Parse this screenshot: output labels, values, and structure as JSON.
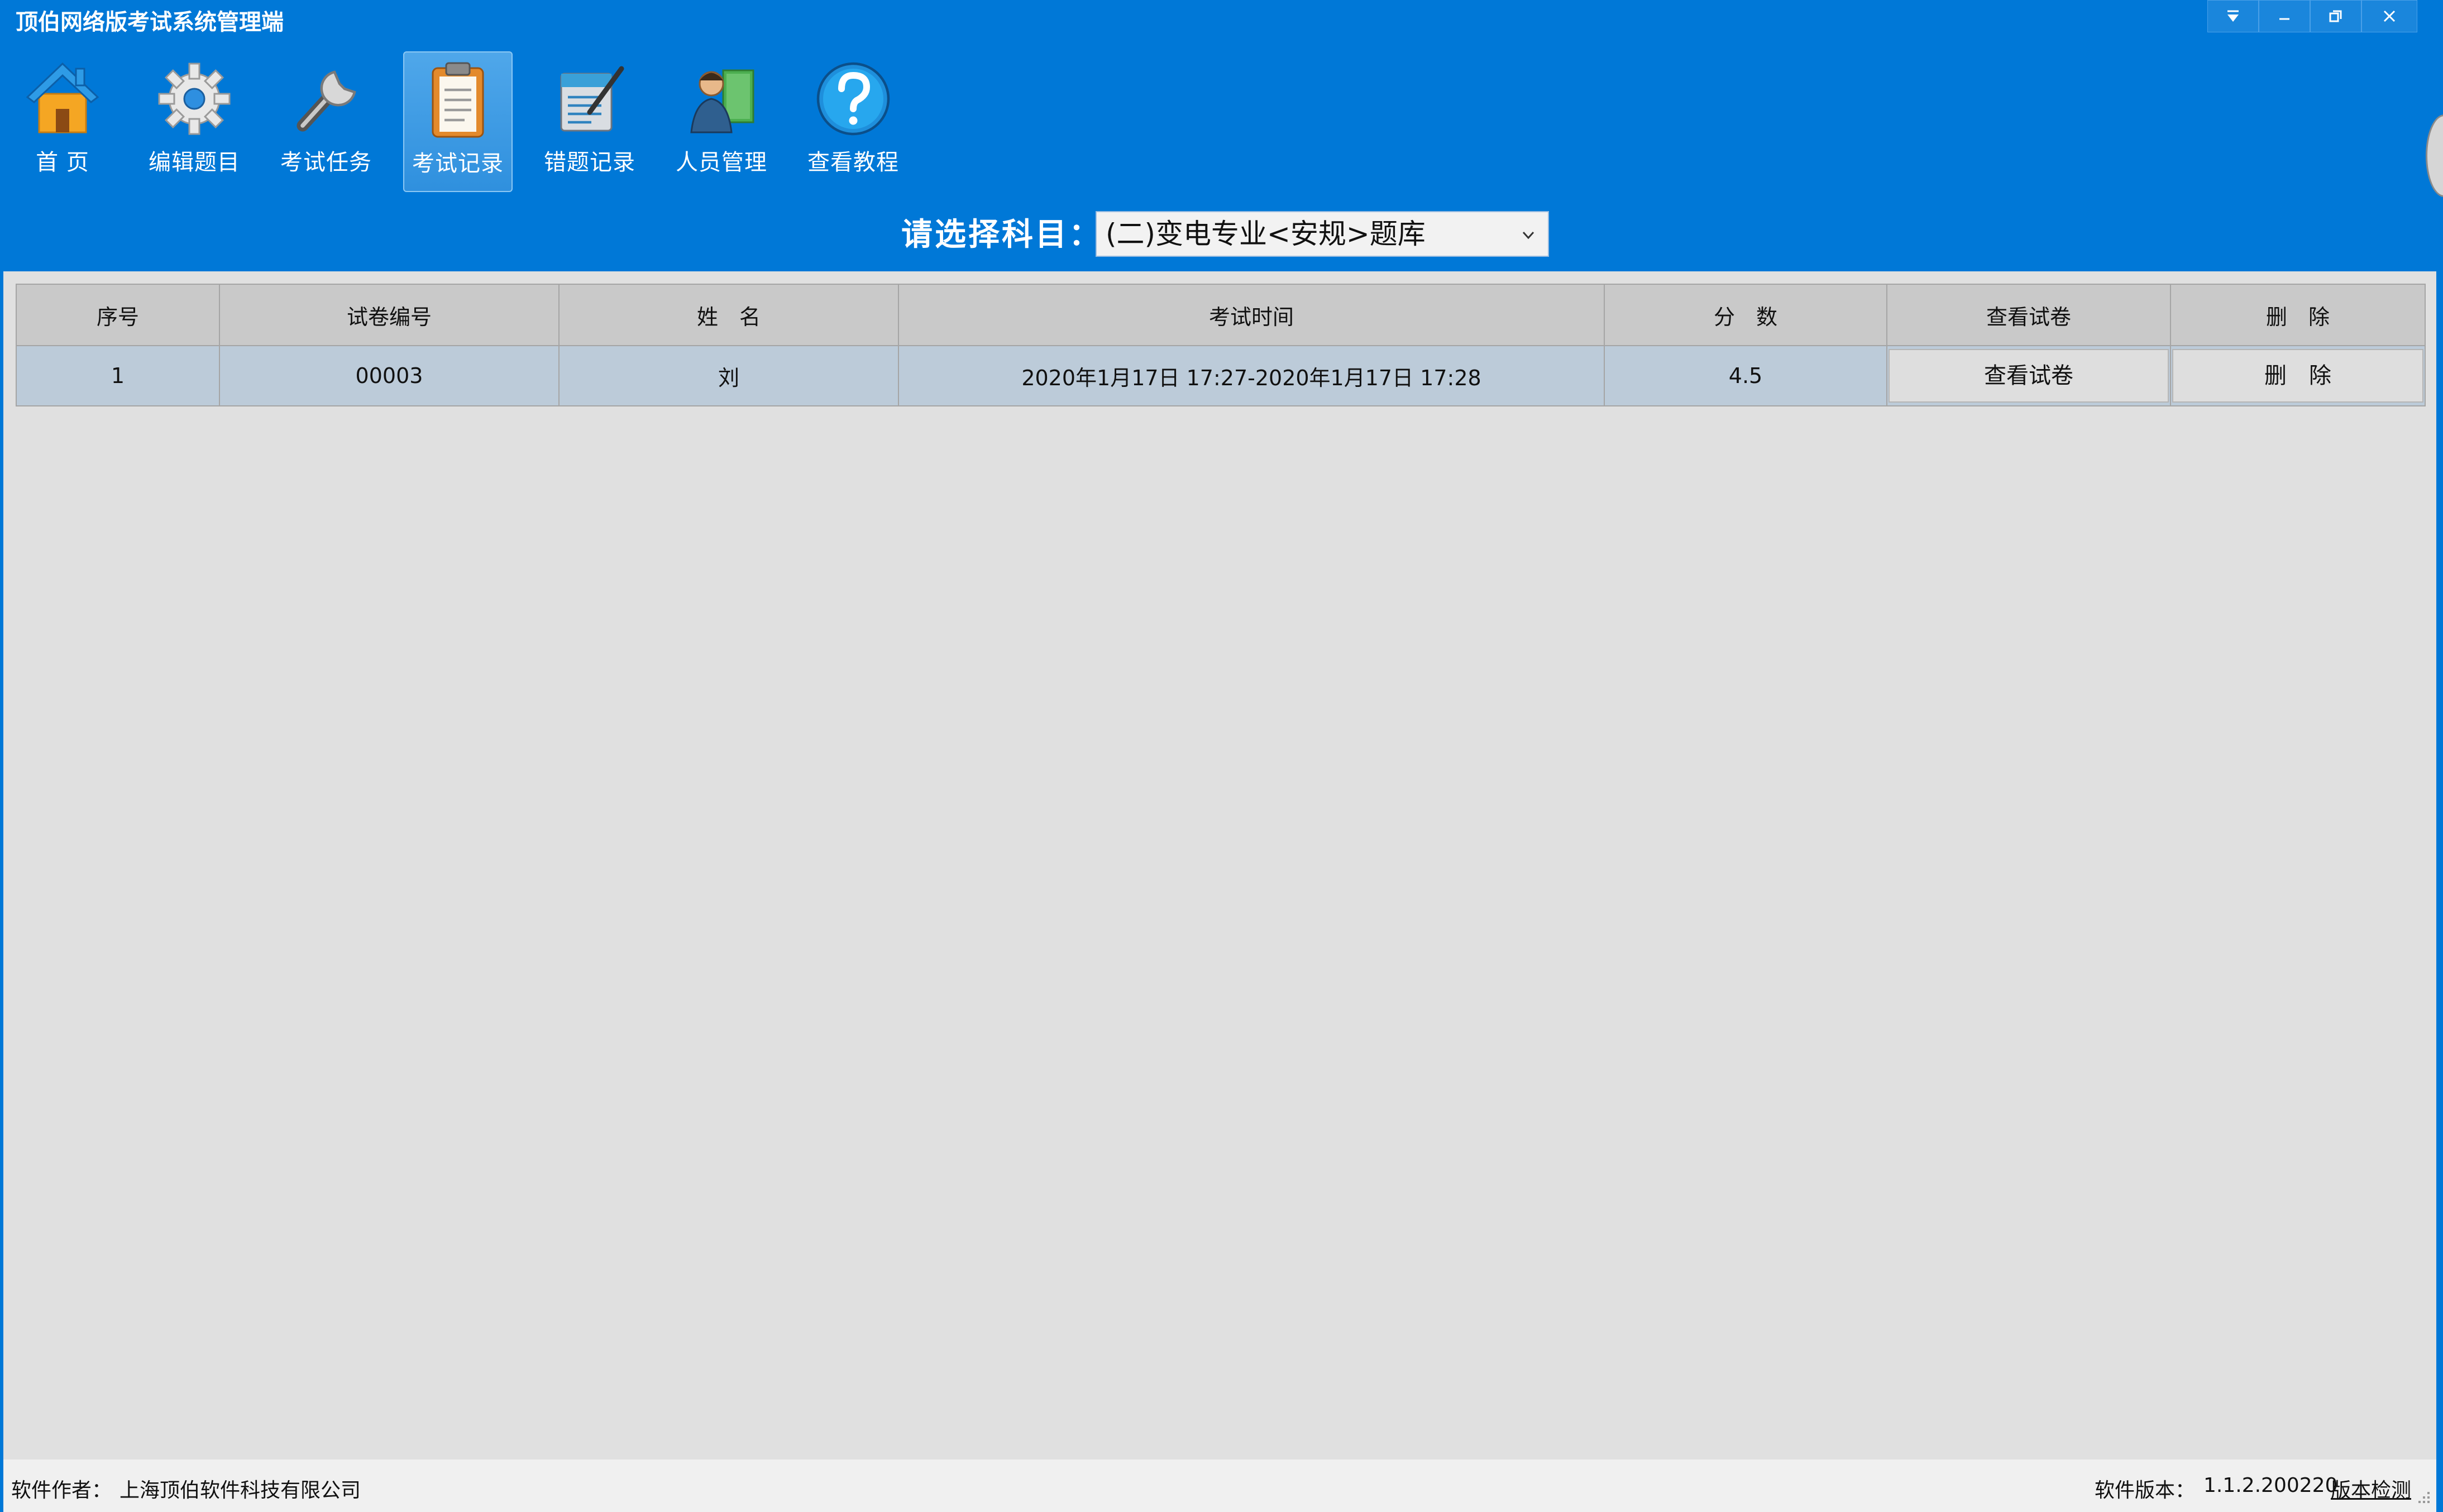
{
  "window": {
    "title": "顶伯网络版考试系统管理端",
    "accent_color": "#0078d7"
  },
  "window_controls": [
    {
      "icon": "dropdown-icon"
    },
    {
      "icon": "minimize-icon"
    },
    {
      "icon": "restore-icon"
    },
    {
      "icon": "close-icon"
    }
  ],
  "toolbar": {
    "items": [
      {
        "label": "首  页",
        "icon": "home-icon"
      },
      {
        "label": "编辑题目",
        "icon": "gear-icon"
      },
      {
        "label": "考试任务",
        "icon": "wrench-icon"
      },
      {
        "label": "考试记录",
        "icon": "clipboard-icon",
        "active": true
      },
      {
        "label": "错题记录",
        "icon": "notebook-pen-icon"
      },
      {
        "label": "人员管理",
        "icon": "person-book-icon"
      },
      {
        "label": "查看教程",
        "icon": "help-icon"
      }
    ]
  },
  "subject": {
    "label": "请选择科目：",
    "selected": "(二)变电专业<安规>题库"
  },
  "table": {
    "headers": [
      "序号",
      "试卷编号",
      "姓　名",
      "考试时间",
      "分　数",
      "查看试卷",
      "删　除"
    ],
    "rows": [
      {
        "index": "1",
        "paper_id": "00003",
        "name": "刘",
        "time": "2020年1月17日 17:27-2020年1月17日 17:28",
        "score": "4.5",
        "view_button": "查看试卷",
        "delete_button": "删　除"
      }
    ]
  },
  "statusbar": {
    "author_label": "软件作者：",
    "author_value": "上海顶伯软件科技有限公司",
    "version_label": "软件版本：",
    "version_value": "1.1.2.200220",
    "check_link": "版本检测"
  }
}
